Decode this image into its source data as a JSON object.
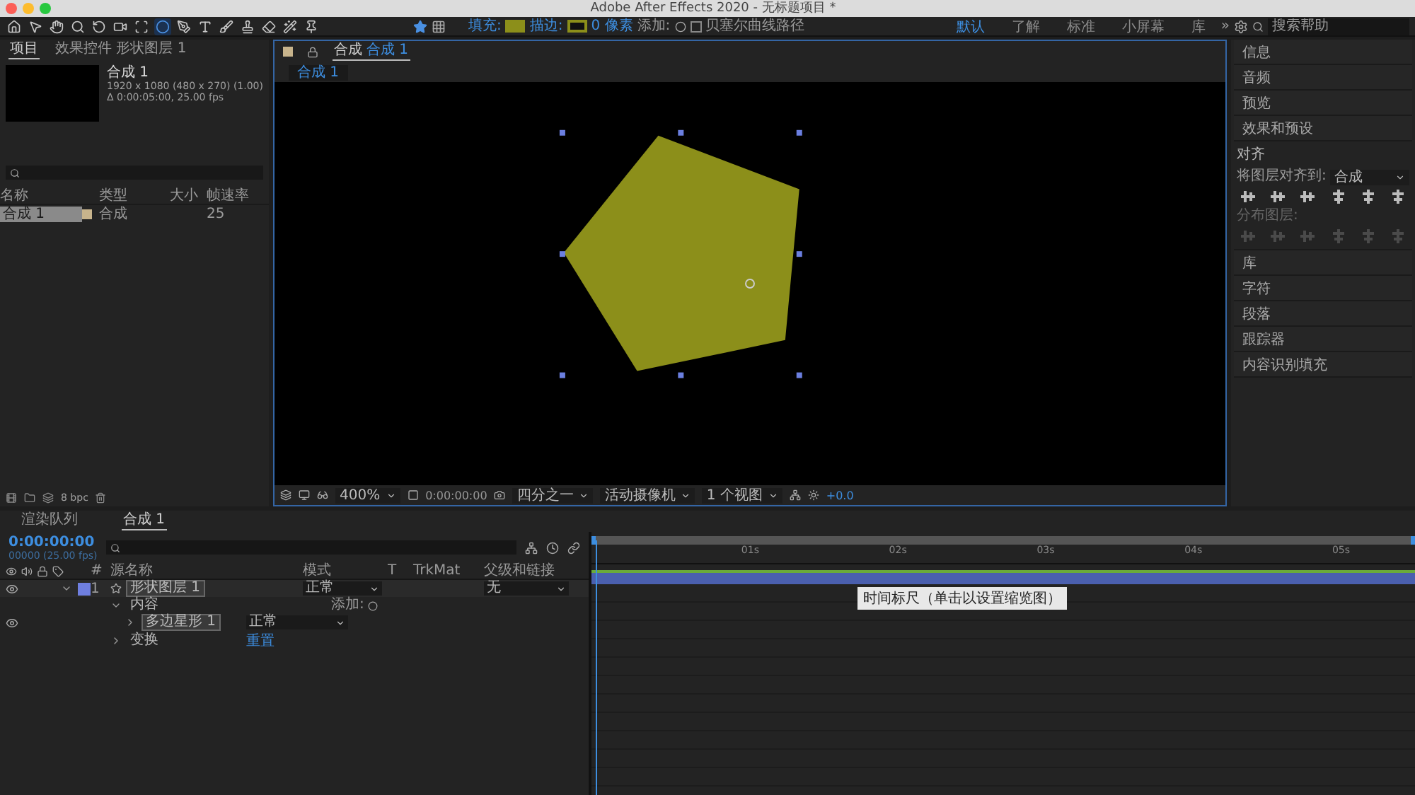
{
  "window": {
    "title": "Adobe After Effects 2020 - 无标题项目 *"
  },
  "toolbar": {
    "tools": [
      {
        "kind": "home",
        "selected": false
      },
      {
        "kind": "select",
        "selected": false
      },
      {
        "kind": "hand",
        "selected": false
      },
      {
        "kind": "zoom",
        "selected": false
      },
      {
        "kind": "rotate",
        "selected": false
      },
      {
        "kind": "camera",
        "selected": false
      },
      {
        "kind": "anchor",
        "selected": false
      },
      {
        "kind": "ellipse",
        "selected": true
      },
      {
        "kind": "pen",
        "selected": false
      },
      {
        "kind": "text",
        "selected": false
      },
      {
        "kind": "brush",
        "selected": false
      },
      {
        "kind": "stamp",
        "selected": false
      },
      {
        "kind": "eraser",
        "selected": false
      },
      {
        "kind": "roto",
        "selected": false
      },
      {
        "kind": "pin",
        "selected": false
      }
    ],
    "fill": {
      "label": "填充:",
      "color": "#8c8f1a"
    },
    "stroke": {
      "label": "描边:",
      "color": "#8c8f1a"
    },
    "stroke_width": "0 像素",
    "add_label": "添加:",
    "bezier": {
      "label": "贝塞尔曲线路径",
      "checked": false
    },
    "workspaces": [
      {
        "label": "默认",
        "selected": true
      },
      {
        "label": "了解",
        "selected": false
      },
      {
        "label": "标准",
        "selected": false
      },
      {
        "label": "小屏幕",
        "selected": false
      },
      {
        "label": "库",
        "selected": false
      }
    ],
    "more": "»",
    "search": {
      "placeholder": "搜索帮助"
    }
  },
  "project_panel": {
    "tabs": [
      {
        "label": "项目",
        "selected": true
      },
      {
        "label": "效果控件 形状图层 1",
        "selected": false
      }
    ],
    "comp_name": "合成 1",
    "comp_size": "1920 x 1080  (480 x 270) (1.00)",
    "comp_duration": "Δ 0:00:05:00, 25.00 fps",
    "columns": [
      "名称",
      "类型",
      "大小",
      "帧速率"
    ],
    "rows": [
      {
        "name": "合成 1",
        "type": "合成",
        "size": "",
        "fps": "25",
        "color": "#c8b48c",
        "selected": true
      }
    ],
    "bpc": "8 bpc"
  },
  "viewer": {
    "tab_prefix": "合成",
    "tab_name": "合成 1",
    "breadcrumb": "合成 1",
    "zoom": "400%",
    "timecode": "0:00:00:00",
    "resolution": "四分之一",
    "camera": "活动摄像机",
    "views": "1 个视图",
    "exposure": "+0.0"
  },
  "right_panel": {
    "items_top": [
      "信息",
      "音频",
      "预览",
      "效果和预设"
    ],
    "align": {
      "title": "对齐",
      "align_to_label": "将图层对齐到:",
      "align_to": "合成",
      "distribute_label": "分布图层:",
      "distribute_disabled": true
    },
    "items_bottom": [
      "库",
      "字符",
      "段落",
      "跟踪器",
      "内容识别填充"
    ]
  },
  "timeline": {
    "tabs": [
      {
        "label": "渲染队列",
        "selected": false
      },
      {
        "label": "合成 1",
        "selected": true
      }
    ],
    "current_time": "0:00:00:00",
    "frame_info": "00000 (25.00 fps)",
    "columns": {
      "number": "#",
      "source_name": "源名称",
      "mode": "模式",
      "t": "T",
      "trkmat": "TrkMat",
      "parent": "父级和链接"
    },
    "layers": [
      {
        "number": "1",
        "name": "形状图层 1",
        "color": "#6f7fe0",
        "visible": true,
        "expanded": true,
        "mode": "正常",
        "parent": "无",
        "children": [
          {
            "name": "内容",
            "expanded": true,
            "add_label": "添加:",
            "children": [
              {
                "name": "多边星形 1",
                "expanded": false,
                "visible": true,
                "mode": "正常"
              }
            ]
          },
          {
            "name": "变换",
            "expanded": false,
            "reset": "重置"
          }
        ]
      }
    ],
    "ruler": [
      "01s",
      "02s",
      "03s",
      "04s",
      "05s"
    ],
    "tooltip": "时间标尺（单击以设置缩览图）"
  }
}
